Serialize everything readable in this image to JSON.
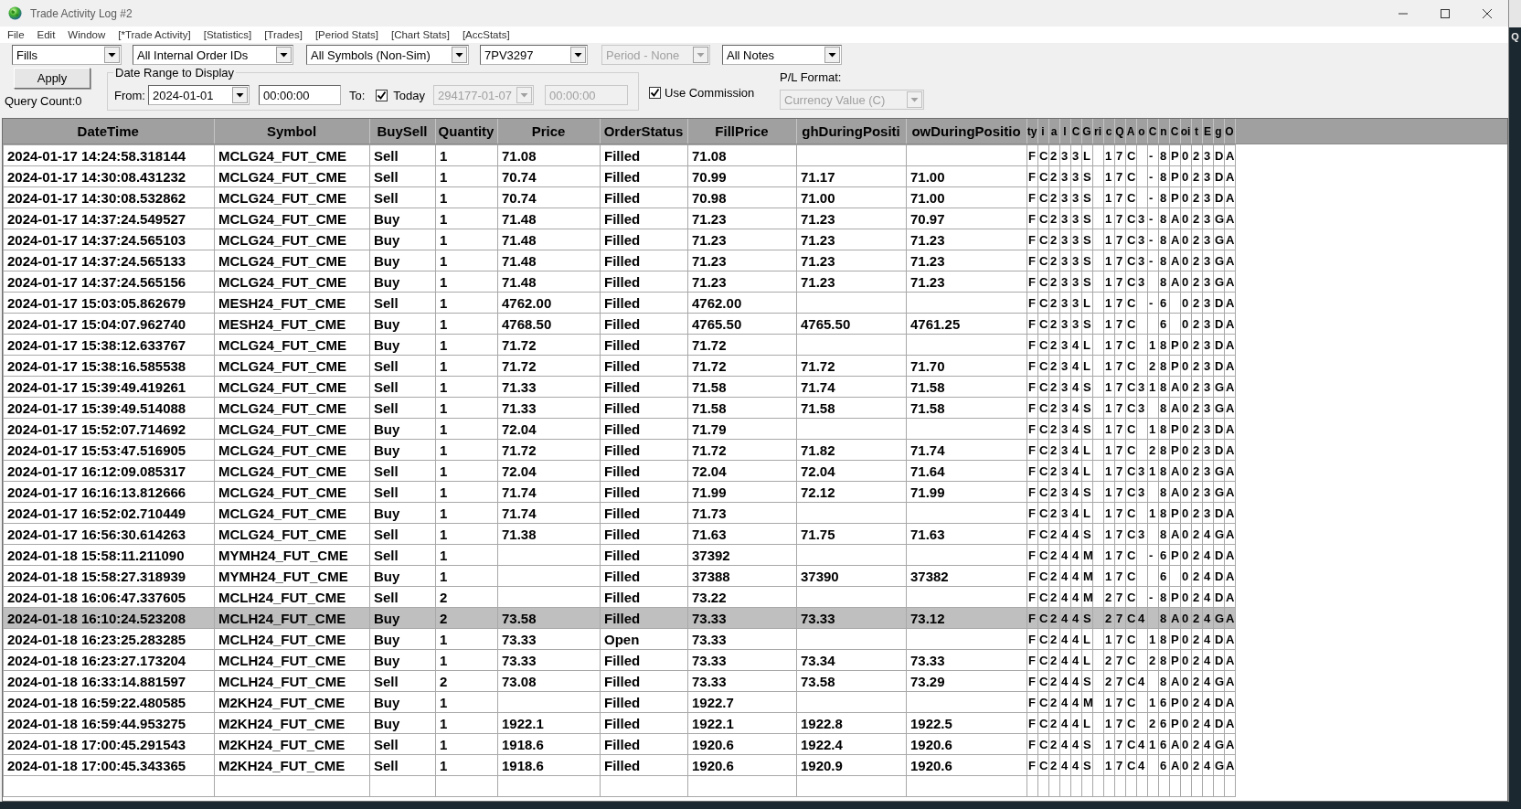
{
  "window": {
    "title": "Trade Activity Log #2"
  },
  "menu": [
    "File",
    "Edit",
    "Window",
    "[*Trade Activity]",
    "[Statistics]",
    "[Trades]",
    "[Period Stats]",
    "[Chart Stats]",
    "[AccStats]"
  ],
  "filters": [
    {
      "value": "Fills",
      "disabled": false
    },
    {
      "value": "All Internal Order IDs",
      "disabled": false
    },
    {
      "value": "All Symbols (Non-Sim)",
      "disabled": false
    },
    {
      "value": "7PV3297",
      "disabled": false
    },
    {
      "value": "Period - None",
      "disabled": true
    },
    {
      "value": "All Notes",
      "disabled": false
    }
  ],
  "apply_button": "Apply",
  "query_count": "Query Count:0",
  "date_range": {
    "title": "Date Range to Display",
    "from_label": "From:",
    "from_date": {
      "value": "2024-01-01",
      "disabled": false
    },
    "from_time": {
      "value": "00:00:00",
      "disabled": false
    },
    "to_label": "To:",
    "today": {
      "label": "Today",
      "checked": true
    },
    "to_date": {
      "value": "294177-01-07",
      "disabled": true
    },
    "to_time": {
      "value": "00:00:00",
      "disabled": true
    }
  },
  "use_commission": {
    "label": "Use Commission",
    "checked": true
  },
  "pl_format": {
    "label": "P/L Format:",
    "value": "Currency Value (C)",
    "disabled": true
  },
  "table": {
    "columns": [
      "DateTime",
      "Symbol",
      "BuySell",
      "Quantity",
      "Price",
      "OrderStatus",
      "FillPrice",
      "ghDuringPositi",
      "owDuringPositio",
      "ty",
      "i",
      "a",
      "l",
      "C",
      "G",
      "ri",
      "c",
      "Q",
      "A",
      "o",
      "C",
      "n",
      "C",
      "oi",
      "t",
      "E",
      "g",
      "O"
    ],
    "rows": [
      {
        "selected": false,
        "cells": [
          "2024-01-17 14:24:58.318144",
          "MCLG24_FUT_CME",
          "Sell",
          "1",
          "71.08",
          "Filled",
          "71.08",
          null,
          null,
          "F",
          "C",
          "2",
          "3",
          "3",
          "L",
          null,
          "1",
          "7",
          "C",
          null,
          "-",
          "8",
          "P",
          "0",
          "2",
          "3",
          "D",
          "A"
        ]
      },
      {
        "selected": false,
        "cells": [
          "2024-01-17 14:30:08.431232",
          "MCLG24_FUT_CME",
          "Sell",
          "1",
          "70.74",
          "Filled",
          "70.99",
          "71.17",
          "71.00",
          "F",
          "C",
          "2",
          "3",
          "3",
          "S",
          null,
          "1",
          "7",
          "C",
          null,
          "-",
          "8",
          "P",
          "0",
          "2",
          "3",
          "D",
          "A"
        ]
      },
      {
        "selected": false,
        "cells": [
          "2024-01-17 14:30:08.532862",
          "MCLG24_FUT_CME",
          "Sell",
          "1",
          "70.74",
          "Filled",
          "70.98",
          "71.00",
          "71.00",
          "F",
          "C",
          "2",
          "3",
          "3",
          "S",
          null,
          "1",
          "7",
          "C",
          null,
          "-",
          "8",
          "P",
          "0",
          "2",
          "3",
          "D",
          "A"
        ]
      },
      {
        "selected": false,
        "cells": [
          "2024-01-17 14:37:24.549527",
          "MCLG24_FUT_CME",
          "Buy",
          "1",
          "71.48",
          "Filled",
          "71.23",
          "71.23",
          "70.97",
          "F",
          "C",
          "2",
          "3",
          "3",
          "S",
          null,
          "1",
          "7",
          "C",
          "3",
          "-",
          "8",
          "A",
          "0",
          "2",
          "3",
          "G",
          "A"
        ]
      },
      {
        "selected": false,
        "cells": [
          "2024-01-17 14:37:24.565103",
          "MCLG24_FUT_CME",
          "Buy",
          "1",
          "71.48",
          "Filled",
          "71.23",
          "71.23",
          "71.23",
          "F",
          "C",
          "2",
          "3",
          "3",
          "S",
          null,
          "1",
          "7",
          "C",
          "3",
          "-",
          "8",
          "A",
          "0",
          "2",
          "3",
          "G",
          "A"
        ]
      },
      {
        "selected": false,
        "cells": [
          "2024-01-17 14:37:24.565133",
          "MCLG24_FUT_CME",
          "Buy",
          "1",
          "71.48",
          "Filled",
          "71.23",
          "71.23",
          "71.23",
          "F",
          "C",
          "2",
          "3",
          "3",
          "S",
          null,
          "1",
          "7",
          "C",
          "3",
          "-",
          "8",
          "A",
          "0",
          "2",
          "3",
          "G",
          "A"
        ]
      },
      {
        "selected": false,
        "cells": [
          "2024-01-17 14:37:24.565156",
          "MCLG24_FUT_CME",
          "Buy",
          "1",
          "71.48",
          "Filled",
          "71.23",
          "71.23",
          "71.23",
          "F",
          "C",
          "2",
          "3",
          "3",
          "S",
          null,
          "1",
          "7",
          "C",
          "3",
          null,
          "8",
          "A",
          "0",
          "2",
          "3",
          "G",
          "A"
        ]
      },
      {
        "selected": false,
        "cells": [
          "2024-01-17 15:03:05.862679",
          "MESH24_FUT_CME",
          "Sell",
          "1",
          "4762.00",
          "Filled",
          "4762.00",
          null,
          null,
          "F",
          "C",
          "2",
          "3",
          "3",
          "L",
          null,
          "1",
          "7",
          "C",
          null,
          "-",
          "6",
          null,
          "0",
          "2",
          "3",
          "D",
          "A"
        ]
      },
      {
        "selected": false,
        "cells": [
          "2024-01-17 15:04:07.962740",
          "MESH24_FUT_CME",
          "Buy",
          "1",
          "4768.50",
          "Filled",
          "4765.50",
          "4765.50",
          "4761.25",
          "F",
          "C",
          "2",
          "3",
          "3",
          "S",
          null,
          "1",
          "7",
          "C",
          null,
          null,
          "6",
          null,
          "0",
          "2",
          "3",
          "D",
          "A"
        ]
      },
      {
        "selected": false,
        "cells": [
          "2024-01-17 15:38:12.633767",
          "MCLG24_FUT_CME",
          "Buy",
          "1",
          "71.72",
          "Filled",
          "71.72",
          null,
          null,
          "F",
          "C",
          "2",
          "3",
          "4",
          "L",
          null,
          "1",
          "7",
          "C",
          null,
          "1",
          "8",
          "P",
          "0",
          "2",
          "3",
          "D",
          "A"
        ]
      },
      {
        "selected": false,
        "cells": [
          "2024-01-17 15:38:16.585538",
          "MCLG24_FUT_CME",
          "Sell",
          "1",
          "71.72",
          "Filled",
          "71.72",
          "71.72",
          "71.70",
          "F",
          "C",
          "2",
          "3",
          "4",
          "L",
          null,
          "1",
          "7",
          "C",
          null,
          "2",
          "8",
          "P",
          "0",
          "2",
          "3",
          "D",
          "A"
        ]
      },
      {
        "selected": false,
        "cells": [
          "2024-01-17 15:39:49.419261",
          "MCLG24_FUT_CME",
          "Sell",
          "1",
          "71.33",
          "Filled",
          "71.58",
          "71.74",
          "71.58",
          "F",
          "C",
          "2",
          "3",
          "4",
          "S",
          null,
          "1",
          "7",
          "C",
          "3",
          "1",
          "8",
          "A",
          "0",
          "2",
          "3",
          "G",
          "A"
        ]
      },
      {
        "selected": false,
        "cells": [
          "2024-01-17 15:39:49.514088",
          "MCLG24_FUT_CME",
          "Sell",
          "1",
          "71.33",
          "Filled",
          "71.58",
          "71.58",
          "71.58",
          "F",
          "C",
          "2",
          "3",
          "4",
          "S",
          null,
          "1",
          "7",
          "C",
          "3",
          null,
          "8",
          "A",
          "0",
          "2",
          "3",
          "G",
          "A"
        ]
      },
      {
        "selected": false,
        "cells": [
          "2024-01-17 15:52:07.714692",
          "MCLG24_FUT_CME",
          "Buy",
          "1",
          "72.04",
          "Filled",
          "71.79",
          null,
          null,
          "F",
          "C",
          "2",
          "3",
          "4",
          "S",
          null,
          "1",
          "7",
          "C",
          null,
          "1",
          "8",
          "P",
          "0",
          "2",
          "3",
          "D",
          "A"
        ]
      },
      {
        "selected": false,
        "cells": [
          "2024-01-17 15:53:47.516905",
          "MCLG24_FUT_CME",
          "Buy",
          "1",
          "71.72",
          "Filled",
          "71.72",
          "71.82",
          "71.74",
          "F",
          "C",
          "2",
          "3",
          "4",
          "L",
          null,
          "1",
          "7",
          "C",
          null,
          "2",
          "8",
          "P",
          "0",
          "2",
          "3",
          "D",
          "A"
        ]
      },
      {
        "selected": false,
        "cells": [
          "2024-01-17 16:12:09.085317",
          "MCLG24_FUT_CME",
          "Sell",
          "1",
          "72.04",
          "Filled",
          "72.04",
          "72.04",
          "71.64",
          "F",
          "C",
          "2",
          "3",
          "4",
          "L",
          null,
          "1",
          "7",
          "C",
          "3",
          "1",
          "8",
          "A",
          "0",
          "2",
          "3",
          "G",
          "A"
        ]
      },
      {
        "selected": false,
        "cells": [
          "2024-01-17 16:16:13.812666",
          "MCLG24_FUT_CME",
          "Sell",
          "1",
          "71.74",
          "Filled",
          "71.99",
          "72.12",
          "71.99",
          "F",
          "C",
          "2",
          "3",
          "4",
          "S",
          null,
          "1",
          "7",
          "C",
          "3",
          null,
          "8",
          "A",
          "0",
          "2",
          "3",
          "G",
          "A"
        ]
      },
      {
        "selected": false,
        "cells": [
          "2024-01-17 16:52:02.710449",
          "MCLG24_FUT_CME",
          "Buy",
          "1",
          "71.74",
          "Filled",
          "71.73",
          null,
          null,
          "F",
          "C",
          "2",
          "3",
          "4",
          "L",
          null,
          "1",
          "7",
          "C",
          null,
          "1",
          "8",
          "P",
          "0",
          "2",
          "3",
          "D",
          "A"
        ]
      },
      {
        "selected": false,
        "cells": [
          "2024-01-17 16:56:30.614263",
          "MCLG24_FUT_CME",
          "Sell",
          "1",
          "71.38",
          "Filled",
          "71.63",
          "71.75",
          "71.63",
          "F",
          "C",
          "2",
          "4",
          "4",
          "S",
          null,
          "1",
          "7",
          "C",
          "3",
          null,
          "8",
          "A",
          "0",
          "2",
          "4",
          "G",
          "A"
        ]
      },
      {
        "selected": false,
        "cells": [
          "2024-01-18 15:58:11.211090",
          "MYMH24_FUT_CME",
          "Sell",
          "1",
          null,
          "Filled",
          "37392",
          null,
          null,
          "F",
          "C",
          "2",
          "4",
          "4",
          "M",
          null,
          "1",
          "7",
          "C",
          null,
          "-",
          "6",
          "P",
          "0",
          "2",
          "4",
          "D",
          "A"
        ]
      },
      {
        "selected": false,
        "cells": [
          "2024-01-18 15:58:27.318939",
          "MYMH24_FUT_CME",
          "Buy",
          "1",
          null,
          "Filled",
          "37388",
          "37390",
          "37382",
          "F",
          "C",
          "2",
          "4",
          "4",
          "M",
          null,
          "1",
          "7",
          "C",
          null,
          null,
          "6",
          null,
          "0",
          "2",
          "4",
          "D",
          "A"
        ]
      },
      {
        "selected": false,
        "cells": [
          "2024-01-18 16:06:47.337605",
          "MCLH24_FUT_CME",
          "Sell",
          "2",
          null,
          "Filled",
          "73.22",
          null,
          null,
          "F",
          "C",
          "2",
          "4",
          "4",
          "M",
          null,
          "2",
          "7",
          "C",
          null,
          "-",
          "8",
          "P",
          "0",
          "2",
          "4",
          "D",
          "A"
        ]
      },
      {
        "selected": true,
        "cells": [
          "2024-01-18 16:10:24.523208",
          "MCLH24_FUT_CME",
          "Buy",
          "2",
          "73.58",
          "Filled",
          "73.33",
          "73.33",
          "73.12",
          "F",
          "C",
          "2",
          "4",
          "4",
          "S",
          null,
          "2",
          "7",
          "C",
          "4",
          null,
          "8",
          "A",
          "0",
          "2",
          "4",
          "G",
          "A"
        ]
      },
      {
        "selected": false,
        "cells": [
          "2024-01-18 16:23:25.283285",
          "MCLH24_FUT_CME",
          "Buy",
          "1",
          "73.33",
          "Open",
          "73.33",
          null,
          null,
          "F",
          "C",
          "2",
          "4",
          "4",
          "L",
          null,
          "1",
          "7",
          "C",
          null,
          "1",
          "8",
          "P",
          "0",
          "2",
          "4",
          "D",
          "A"
        ]
      },
      {
        "selected": false,
        "cells": [
          "2024-01-18 16:23:27.173204",
          "MCLH24_FUT_CME",
          "Buy",
          "1",
          "73.33",
          "Filled",
          "73.33",
          "73.34",
          "73.33",
          "F",
          "C",
          "2",
          "4",
          "4",
          "L",
          null,
          "2",
          "7",
          "C",
          null,
          "2",
          "8",
          "P",
          "0",
          "2",
          "4",
          "D",
          "A"
        ]
      },
      {
        "selected": false,
        "cells": [
          "2024-01-18 16:33:14.881597",
          "MCLH24_FUT_CME",
          "Sell",
          "2",
          "73.08",
          "Filled",
          "73.33",
          "73.58",
          "73.29",
          "F",
          "C",
          "2",
          "4",
          "4",
          "S",
          null,
          "2",
          "7",
          "C",
          "4",
          null,
          "8",
          "A",
          "0",
          "2",
          "4",
          "G",
          "A"
        ]
      },
      {
        "selected": false,
        "cells": [
          "2024-01-18 16:59:22.480585",
          "M2KH24_FUT_CME",
          "Buy",
          "1",
          null,
          "Filled",
          "1922.7",
          null,
          null,
          "F",
          "C",
          "2",
          "4",
          "4",
          "M",
          null,
          "1",
          "7",
          "C",
          null,
          "1",
          "6",
          "P",
          "0",
          "2",
          "4",
          "D",
          "A"
        ]
      },
      {
        "selected": false,
        "cells": [
          "2024-01-18 16:59:44.953275",
          "M2KH24_FUT_CME",
          "Buy",
          "1",
          "1922.1",
          "Filled",
          "1922.1",
          "1922.8",
          "1922.5",
          "F",
          "C",
          "2",
          "4",
          "4",
          "L",
          null,
          "1",
          "7",
          "C",
          null,
          "2",
          "6",
          "P",
          "0",
          "2",
          "4",
          "D",
          "A"
        ]
      },
      {
        "selected": false,
        "cells": [
          "2024-01-18 17:00:45.291543",
          "M2KH24_FUT_CME",
          "Sell",
          "1",
          "1918.6",
          "Filled",
          "1920.6",
          "1922.4",
          "1920.6",
          "F",
          "C",
          "2",
          "4",
          "4",
          "S",
          null,
          "1",
          "7",
          "C",
          "4",
          "1",
          "6",
          "A",
          "0",
          "2",
          "4",
          "G",
          "A"
        ]
      },
      {
        "selected": false,
        "cells": [
          "2024-01-18 17:00:45.343365",
          "M2KH24_FUT_CME",
          "Sell",
          "1",
          "1918.6",
          "Filled",
          "1920.6",
          "1920.9",
          "1920.6",
          "F",
          "C",
          "2",
          "4",
          "4",
          "S",
          null,
          "1",
          "7",
          "C",
          "4",
          null,
          "6",
          "A",
          "0",
          "2",
          "4",
          "G",
          "A"
        ]
      }
    ]
  },
  "background_window": {
    "text": "Q"
  }
}
